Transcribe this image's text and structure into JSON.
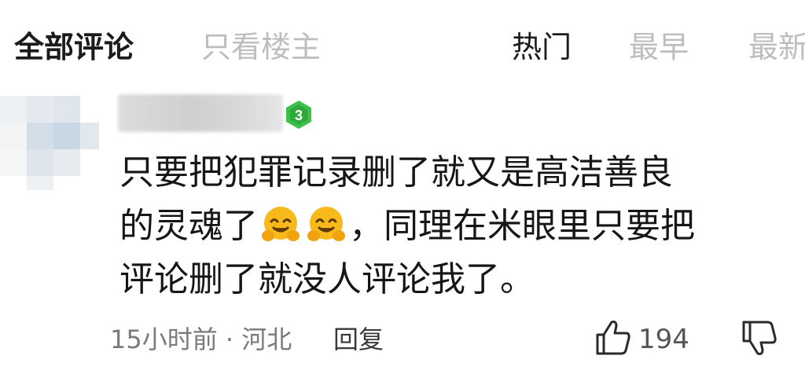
{
  "header": {
    "tab_all": "全部评论",
    "tab_op_only": "只看楼主",
    "sort_hot": "热门",
    "sort_earliest": "最早",
    "sort_newest": "最新"
  },
  "comment": {
    "level_badge": "3",
    "text_line1": "只要把犯罪记录删了就又是高洁善良",
    "text_line2_a": "的灵魂了",
    "text_line2_b": "，同理在米眼里只要把",
    "text_line3": "评论删了就没人评论我了。",
    "emoji": "hugging-face-emoji",
    "time_location": "15小时前 · 河北",
    "reply_label": "回复",
    "like_count": "194"
  },
  "colors": {
    "primary_text": "#1b1b1b",
    "muted_text": "#bdbdbd",
    "meta_text": "#7a7a7a",
    "level_green": "#3cc24a",
    "emoji_yellow": "#f7b91c"
  }
}
